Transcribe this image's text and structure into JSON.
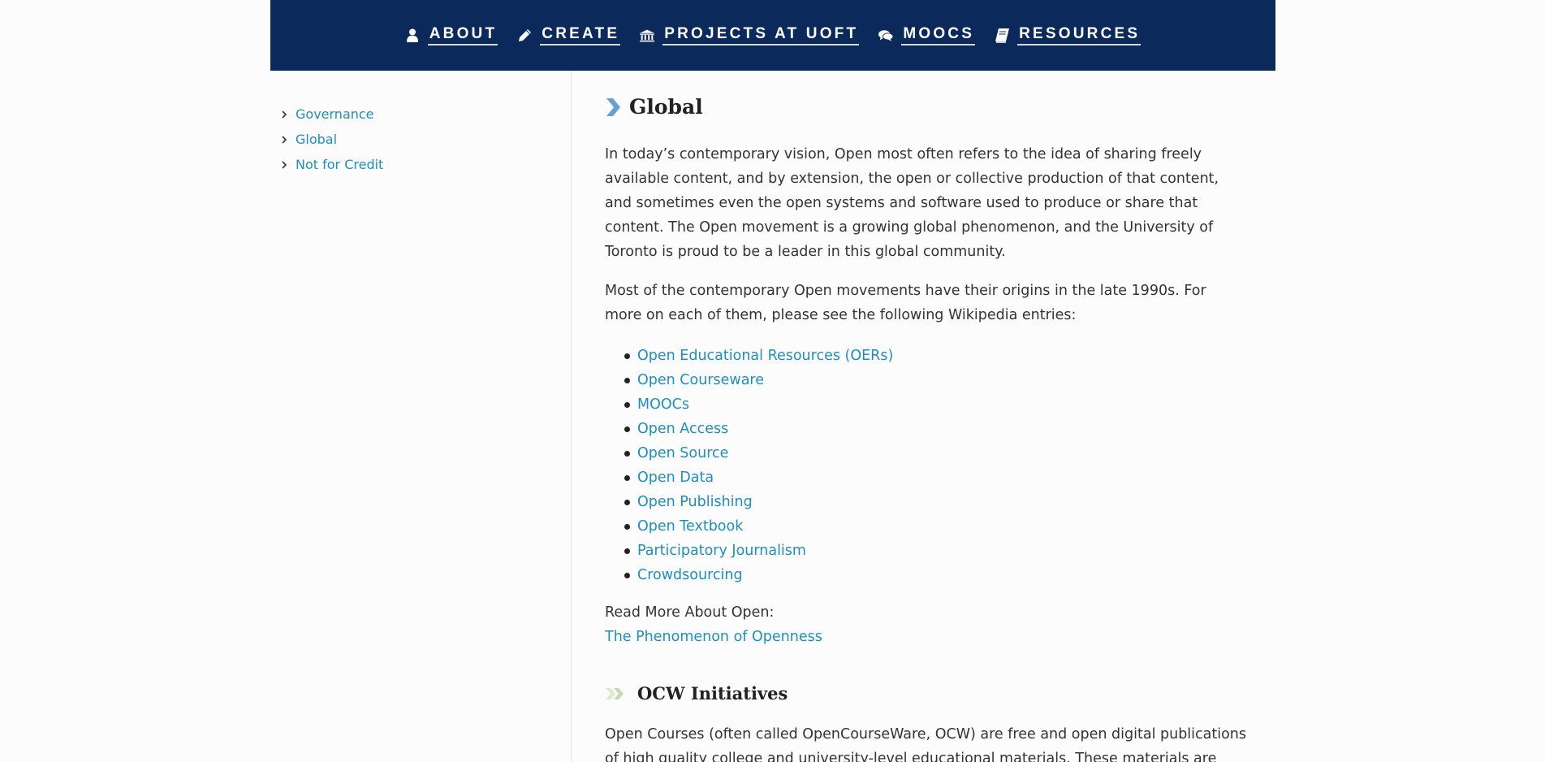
{
  "nav": {
    "items": [
      {
        "label": "ABOUT",
        "icon": "user-icon"
      },
      {
        "label": "CREATE",
        "icon": "pencil-icon"
      },
      {
        "label": "PROJECTS AT UOFT",
        "icon": "institution-icon"
      },
      {
        "label": "MOOCS",
        "icon": "comments-icon"
      },
      {
        "label": "RESOURCES",
        "icon": "book-icon"
      }
    ]
  },
  "sidebar": {
    "items": [
      {
        "label": "Governance"
      },
      {
        "label": "Global"
      },
      {
        "label": "Not for Credit"
      }
    ]
  },
  "main": {
    "title": "Global",
    "paragraph1": "In today’s contemporary vision, Open most often refers to the idea of sharing freely available content, and by extension, the open or collective production of that content, and sometimes even the open systems and software used to produce or share that content. The Open movement is a growing global phenomenon, and the University of Toronto is proud to be a leader in this global community.",
    "paragraph2": "Most of the contemporary Open movements have their origins in the late 1990s. For more on each of them, please see the following Wikipedia entries:",
    "links": [
      "Open Educational Resources (OERs)",
      "Open Courseware",
      "MOOCs",
      "Open Access",
      "Open Source",
      "Open Data",
      "Open Publishing",
      "Open Textbook",
      "Participatory Journalism",
      "Crowdsourcing"
    ],
    "read_more_label": "Read More About Open:",
    "read_more_link": "The Phenomenon of Openness",
    "subheading": "OCW Initiatives",
    "paragraph3": "Open Courses (often called OpenCourseWare, OCW) are free and open digital publications of high quality college and university-level educational materials.  These materials are"
  },
  "colors": {
    "nav_bg": "#0b2a5b",
    "link": "#1e8fbd",
    "heading_icon": "#6a9fd4",
    "subheading_icon": "#c8d8b0"
  }
}
